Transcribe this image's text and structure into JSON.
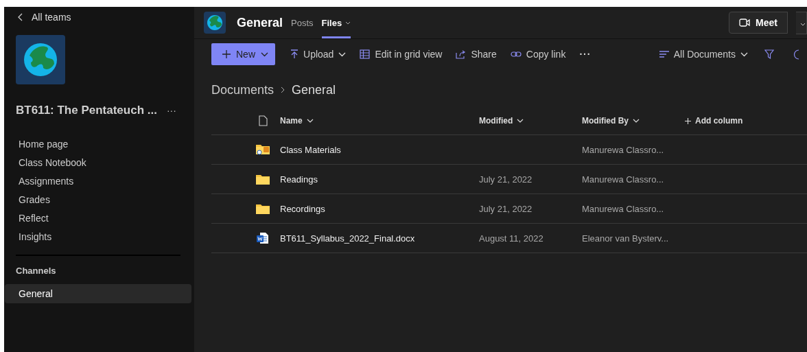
{
  "sidebar": {
    "back": "All teams",
    "team_name": "BT611: The Pentateuch ...",
    "more": "···",
    "items": [
      {
        "label": "Home page",
        "selected": false
      },
      {
        "label": "Class Notebook",
        "selected": false
      },
      {
        "label": "Assignments",
        "selected": false
      },
      {
        "label": "Grades",
        "selected": false
      },
      {
        "label": "Reflect",
        "selected": false
      },
      {
        "label": "Insights",
        "selected": false
      }
    ],
    "channels_heading": "Channels",
    "channels": [
      {
        "label": "General",
        "selected": true
      }
    ]
  },
  "header": {
    "channel": "General",
    "tabs": [
      {
        "label": "Posts",
        "selected": false
      },
      {
        "label": "Files",
        "selected": true
      }
    ],
    "meet": "Meet"
  },
  "toolbar": {
    "new": "New",
    "actions": [
      {
        "kind": "upload",
        "label": "Upload"
      },
      {
        "kind": "grid",
        "label": "Edit in grid view"
      },
      {
        "kind": "share",
        "label": "Share"
      },
      {
        "kind": "link",
        "label": "Copy link"
      }
    ],
    "more": "···",
    "view": "All Documents"
  },
  "breadcrumb": [
    "Documents",
    "General"
  ],
  "table": {
    "columns": [
      "Name",
      "Modified",
      "Modified By"
    ],
    "add_column": "Add column",
    "rows": [
      {
        "kind": "shared-folder",
        "name": "Class Materials",
        "modified": "",
        "modified_by": "Manurewa Classro..."
      },
      {
        "kind": "folder",
        "name": "Readings",
        "modified": "July 21, 2022",
        "modified_by": "Manurewa Classro..."
      },
      {
        "kind": "folder",
        "name": "Recordings",
        "modified": "July 21, 2022",
        "modified_by": "Manurewa Classro..."
      },
      {
        "kind": "word",
        "name": "BT611_Syllabus_2022_Final.docx",
        "modified": "August 11, 2022",
        "modified_by": "Eleanor van Bysterv..."
      }
    ]
  }
}
